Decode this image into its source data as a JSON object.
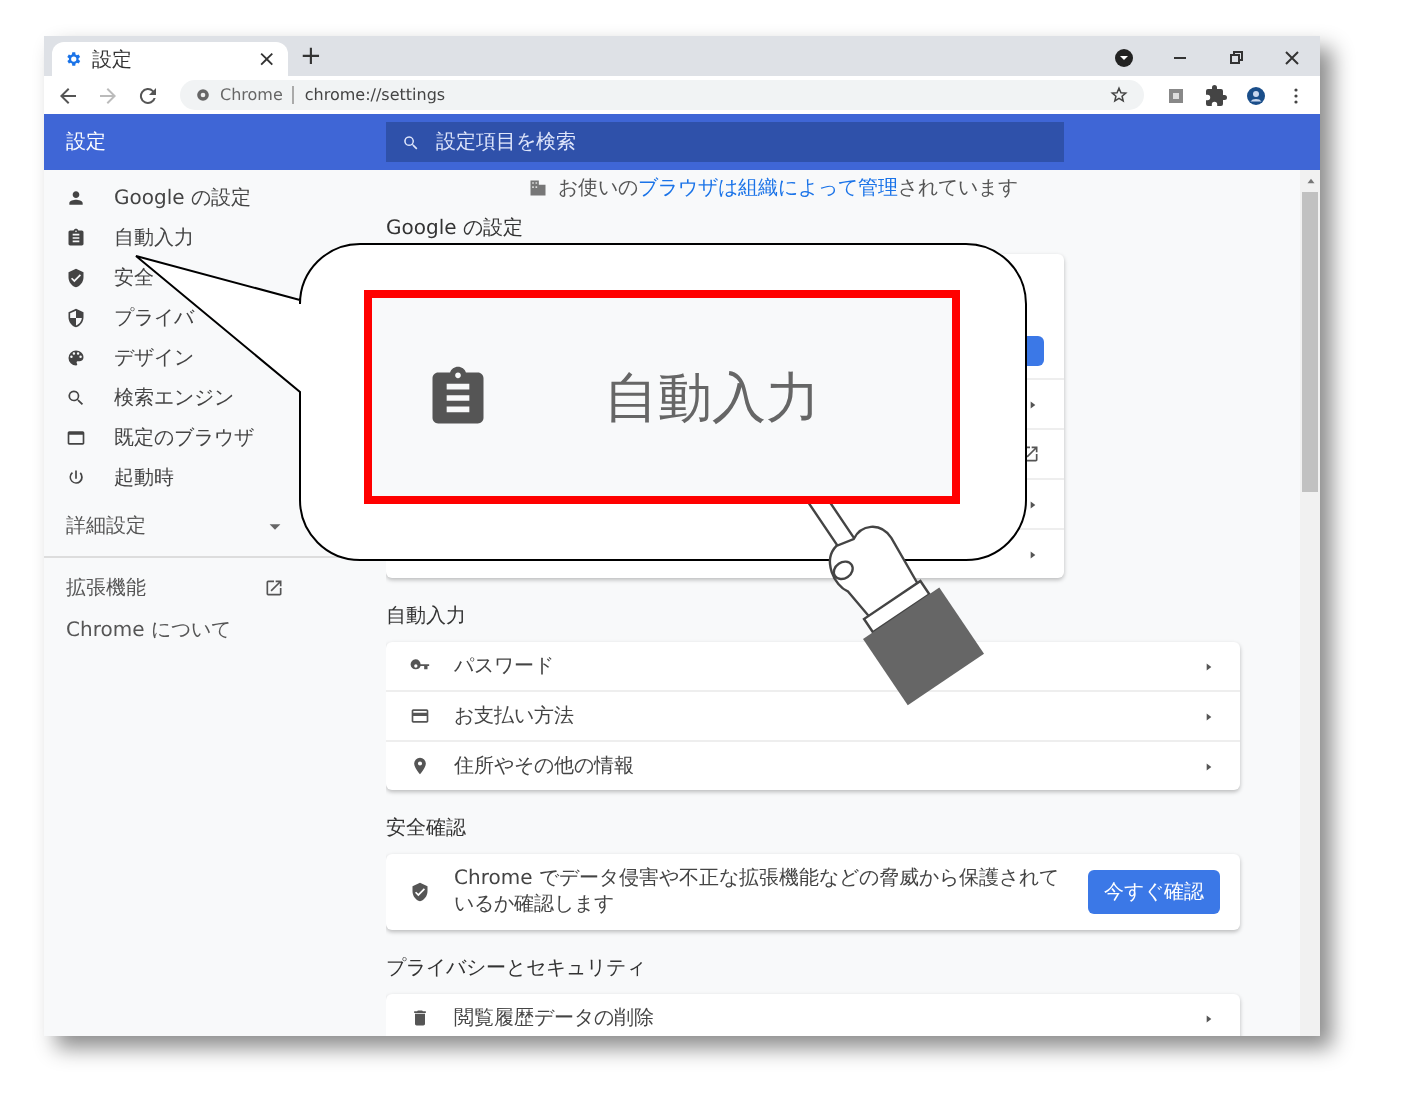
{
  "tab": {
    "title": "設定",
    "close": "×",
    "new_tab": "+"
  },
  "address": {
    "site": "Chrome",
    "url": "chrome://settings"
  },
  "header": {
    "title": "設定",
    "search_placeholder": "設定項目を検索"
  },
  "sidebar": {
    "items": [
      {
        "label": "Google の設定",
        "selected": false
      },
      {
        "label": "自動入力",
        "selected": false
      },
      {
        "label": "安全",
        "selected": false
      },
      {
        "label": "プライバ",
        "selected": false
      },
      {
        "label": "デザイン",
        "selected": false
      },
      {
        "label": "検索エンジン",
        "selected": false
      },
      {
        "label": "既定のブラウザ",
        "selected": false
      },
      {
        "label": "起動時",
        "selected": false
      }
    ],
    "advanced": "詳細設定",
    "extensions": "拡張機能",
    "about": "Chrome について"
  },
  "managed_notice": {
    "prefix": "お使いの",
    "link": "ブラウザは組織によって管理",
    "suffix": "されています"
  },
  "google_section": {
    "title": "Google の設定"
  },
  "sections": [
    {
      "title": "自動入力",
      "rows": [
        {
          "kind": "link",
          "label": "パスワード"
        },
        {
          "kind": "link",
          "label": "お支払い方法"
        },
        {
          "kind": "link",
          "label": "住所やその他の情報"
        }
      ]
    },
    {
      "title": "安全確認",
      "rows": [
        {
          "kind": "action",
          "label": "Chrome でデータ侵害や不正な拡張機能などの脅威から保護されているか確認します",
          "button": "今すぐ確認"
        }
      ]
    },
    {
      "title": "プライバシーとセキュリティ",
      "rows": [
        {
          "kind": "link",
          "label": "閲覧履歴データの削除"
        }
      ]
    }
  ],
  "callout": {
    "label": "自動入力"
  }
}
